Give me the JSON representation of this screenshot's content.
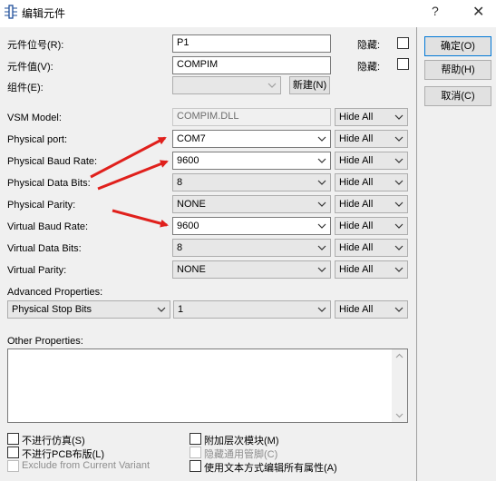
{
  "window": {
    "title": "编辑元件",
    "help_glyph": "?",
    "close_glyph": "✕"
  },
  "dialog_buttons": {
    "ok": "确定(O)",
    "help": "帮助(H)",
    "cancel": "取消(C)"
  },
  "basic": {
    "ref_label": "元件位号(R):",
    "ref_value": "P1",
    "value_label": "元件值(V):",
    "value_value": "COMPIM",
    "group_label": "组件(E):",
    "group_value": "",
    "new_button": "新建(N)",
    "hidden_label": "隐藏:"
  },
  "properties": [
    {
      "label": "VSM Model:",
      "value": "COMPIM.DLL",
      "kind": "readonly",
      "visibility": "Hide All"
    },
    {
      "label": "Physical port:",
      "value": "COM7",
      "kind": "combo",
      "visibility": "Hide All"
    },
    {
      "label": "Physical Baud Rate:",
      "value": "9600",
      "kind": "combo",
      "visibility": "Hide All"
    },
    {
      "label": "Physical Data Bits:",
      "value": "8",
      "kind": "combo",
      "visibility": "Hide All"
    },
    {
      "label": "Physical Parity:",
      "value": "NONE",
      "kind": "combo",
      "visibility": "Hide All"
    },
    {
      "label": "Virtual Baud Rate:",
      "value": "9600",
      "kind": "combo",
      "visibility": "Hide All"
    },
    {
      "label": "Virtual Data Bits:",
      "value": "8",
      "kind": "combo",
      "visibility": "Hide All"
    },
    {
      "label": "Virtual Parity:",
      "value": "NONE",
      "kind": "combo",
      "visibility": "Hide All"
    }
  ],
  "advanced": {
    "label": "Advanced Properties:",
    "property": "Physical Stop Bits",
    "value": "1",
    "visibility": "Hide All"
  },
  "other": {
    "label": "Other Properties:",
    "text": ""
  },
  "options": {
    "exclude_sim": "不进行仿真(S)",
    "exclude_pcb": "不进行PCB布版(L)",
    "exclude_variant": "Exclude from Current Variant",
    "attach_module": "附加层次模块(M)",
    "hide_pins": "隐藏通用管脚(C)",
    "edit_text": "使用文本方式编辑所有属性(A)"
  },
  "colors": {
    "arrow": "#e0201c",
    "accent_border": "#0078d7"
  }
}
